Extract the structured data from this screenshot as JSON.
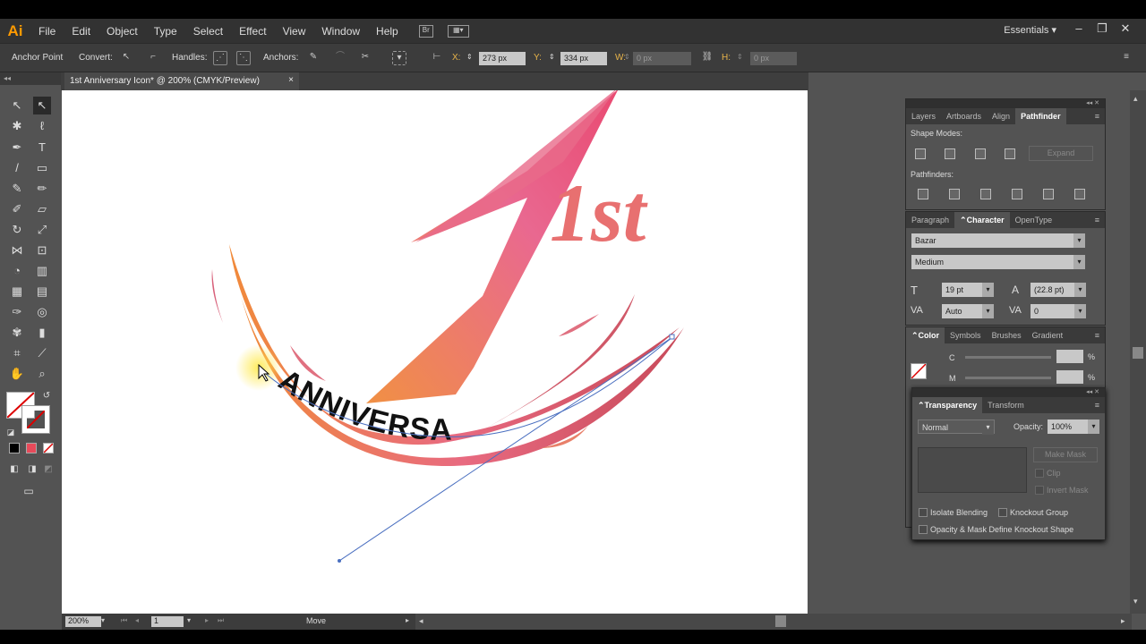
{
  "app": {
    "logo": "Ai",
    "workspace": "Essentials"
  },
  "menu": [
    "File",
    "Edit",
    "Object",
    "Type",
    "Select",
    "Effect",
    "View",
    "Window",
    "Help"
  ],
  "control": {
    "anchor_point": "Anchor Point",
    "convert": "Convert:",
    "handles": "Handles:",
    "anchors": "Anchors:",
    "x_label": "X:",
    "x_value": "273 px",
    "y_label": "Y:",
    "y_value": "334 px",
    "w_label": "W:",
    "w_value": "0 px",
    "h_label": "H:",
    "h_value": "0 px"
  },
  "document": {
    "tab_title": "1st Anniversary Icon* @ 200% (CMYK/Preview)",
    "close": "×"
  },
  "artwork": {
    "big_text": "1st",
    "curve_text": "ANNIVERSARY"
  },
  "status": {
    "zoom": "200%",
    "page": "1",
    "tool": "Move"
  },
  "panels": {
    "pathfinder": {
      "tabs": [
        "Layers",
        "Artboards",
        "Align",
        "Pathfinder"
      ],
      "active": "Pathfinder",
      "shape_modes": "Shape Modes:",
      "pathfinders": "Pathfinders:",
      "expand": "Expand"
    },
    "character": {
      "tabs": [
        "Paragraph",
        "Character",
        "OpenType"
      ],
      "active": "Character",
      "font": "Bazar",
      "style": "Medium",
      "size": "19 pt",
      "leading": "(22.8 pt)",
      "kerning": "Auto",
      "tracking": "0"
    },
    "color": {
      "tabs": [
        "Color",
        "Symbols",
        "Brushes",
        "Gradient"
      ],
      "active": "Color",
      "c_label": "C",
      "m_label": "M",
      "pct": "%"
    },
    "transparency": {
      "tabs": [
        "Transparency",
        "Transform"
      ],
      "active": "Transparency",
      "mode": "Normal",
      "opacity_label": "Opacity:",
      "opacity": "100%",
      "make_mask": "Make Mask",
      "clip": "Clip",
      "invert_mask": "Invert Mask",
      "isolate": "Isolate Blending",
      "knockout": "Knockout Group",
      "opacity_mask": "Opacity & Mask Define Knockout Shape"
    }
  },
  "colors": {
    "accent_orange": "#ff9a00",
    "art_pink": "#e8608a",
    "art_orange": "#f08a3a",
    "path_blue": "#4a6fc0"
  }
}
